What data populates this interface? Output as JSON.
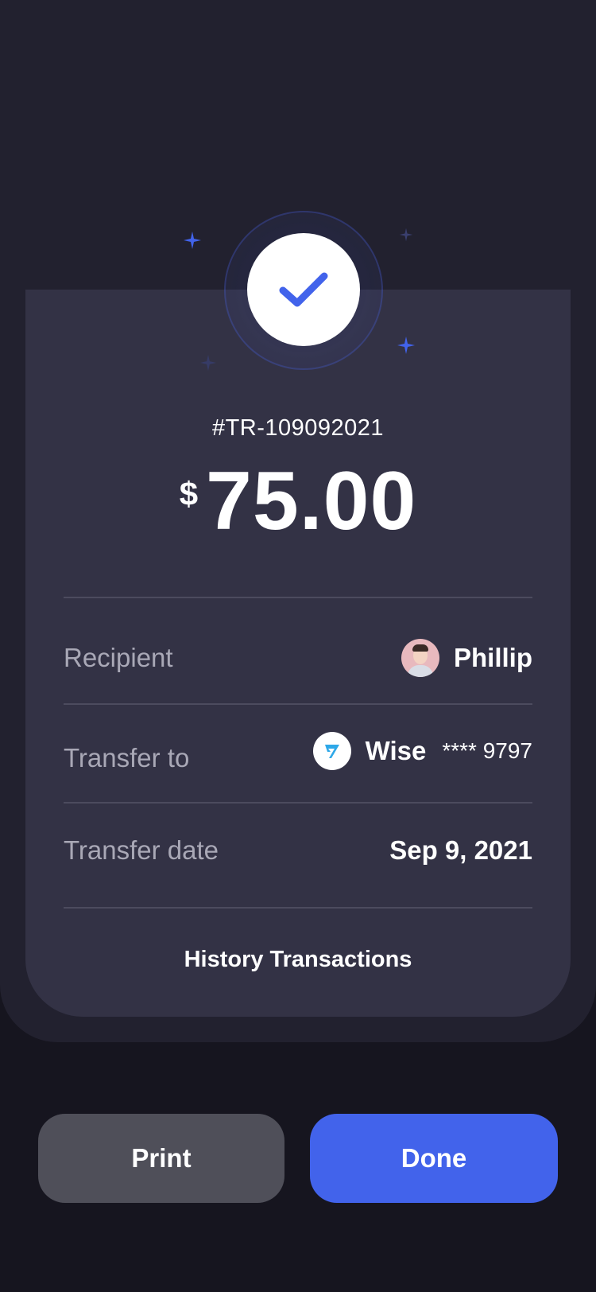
{
  "transaction": {
    "id": "#TR-109092021",
    "currency_symbol": "$",
    "amount": "75.00"
  },
  "details": {
    "recipient": {
      "label": "Recipient",
      "name": "Phillip"
    },
    "transfer_to": {
      "label": "Transfer to",
      "bank": "Wise",
      "account_masked": "**** 9797"
    },
    "transfer_date": {
      "label": "Transfer date",
      "value": "Sep 9, 2021"
    }
  },
  "history_link": "History Transactions",
  "actions": {
    "print_label": "Print",
    "done_label": "Done"
  },
  "colors": {
    "background": "#16151f",
    "panel": "#22212f",
    "card": "#333245",
    "accent": "#4263eb",
    "secondary_button": "#4f4f59",
    "muted_text": "#a9a8b6",
    "wise_logo": "#2ea8e8"
  },
  "icons": {
    "success": "checkmark-icon",
    "decoration": "sparkle-icon",
    "recipient": "avatar",
    "bank": "wise-logo-icon"
  }
}
